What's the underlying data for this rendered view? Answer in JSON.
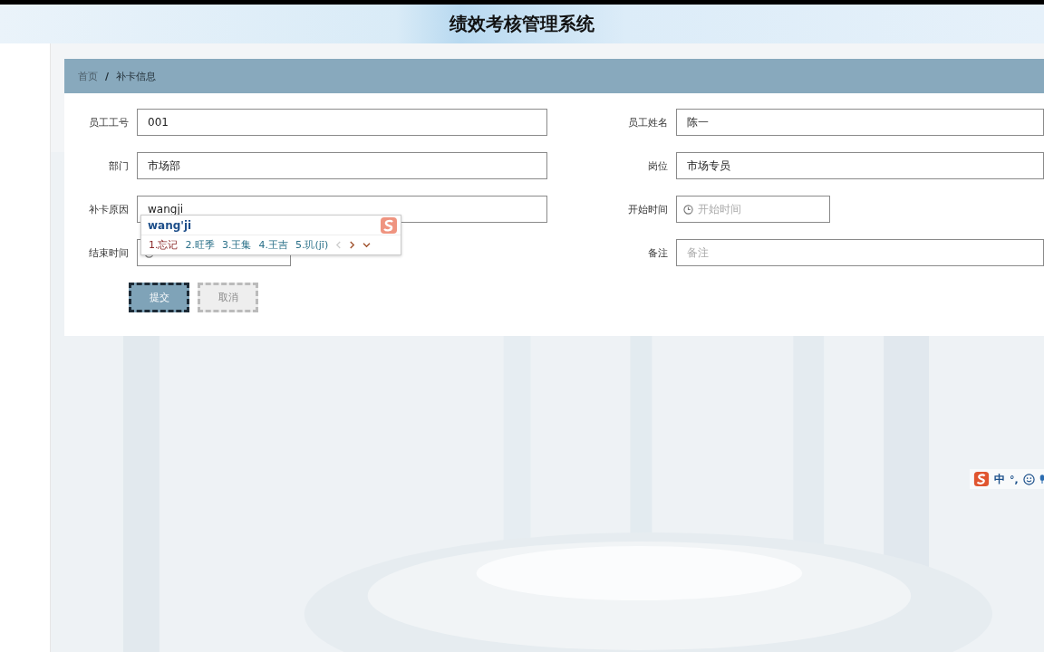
{
  "header": {
    "title": "绩效考核管理系统"
  },
  "breadcrumb": {
    "items": [
      {
        "label": "首页",
        "current": false
      },
      {
        "label": "补卡信息",
        "current": true
      }
    ],
    "separator": "/"
  },
  "fields": [
    {
      "label": "员工工号",
      "kind": "text",
      "value": "001"
    },
    {
      "label": "员工姓名",
      "kind": "text",
      "value": "陈一"
    },
    {
      "label": "部门",
      "kind": "text",
      "value": "市场部"
    },
    {
      "label": "岗位",
      "kind": "text",
      "value": "市场专员"
    },
    {
      "label": "补卡原因",
      "kind": "text",
      "value": "wangji"
    },
    {
      "label": "开始时间",
      "kind": "time",
      "placeholder": "开始时间"
    },
    {
      "label": "结束时间",
      "kind": "time"
    },
    {
      "label": "备注",
      "kind": "text",
      "placeholder": "备注"
    }
  ],
  "buttons": [
    {
      "label": "提交",
      "kind": "primary"
    },
    {
      "label": "取消",
      "kind": "default"
    }
  ],
  "ime_popup": {
    "composition": "wang'ji",
    "candidates": [
      {
        "number": "1.",
        "text": "忘记",
        "selected": true
      },
      {
        "number": "2.",
        "text": "旺季",
        "selected": false
      },
      {
        "number": "3.",
        "text": "王集",
        "selected": false
      },
      {
        "number": "4.",
        "text": "王吉",
        "selected": false
      },
      {
        "number": "5.",
        "text": "玑(jī)",
        "selected": false
      }
    ]
  },
  "ime_status": {
    "mode": "中",
    "punctuation": "°,"
  }
}
